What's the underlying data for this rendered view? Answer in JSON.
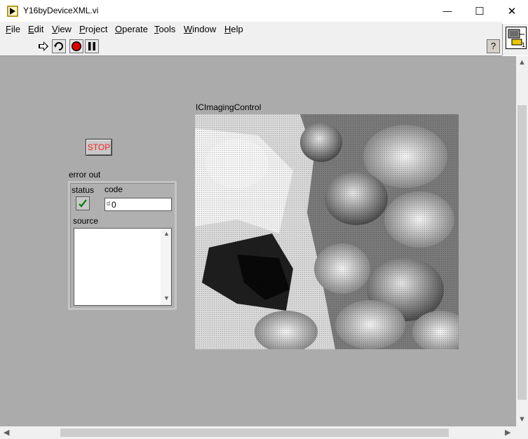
{
  "window": {
    "title": "Y16byDeviceXML.vi",
    "minimize_glyph": "—",
    "maximize_glyph": "☐",
    "close_glyph": "✕"
  },
  "menu": [
    {
      "accel": "F",
      "rest": "ile"
    },
    {
      "accel": "E",
      "rest": "dit"
    },
    {
      "accel": "V",
      "rest": "iew"
    },
    {
      "accel": "P",
      "rest": "roject"
    },
    {
      "accel": "O",
      "rest": "perate"
    },
    {
      "accel": "T",
      "rest": "ools"
    },
    {
      "accel": "W",
      "rest": "indow"
    },
    {
      "accel": "H",
      "rest": "elp"
    }
  ],
  "toolbar": {
    "help_glyph": "?",
    "icons": [
      "run-icon",
      "run-continuously-icon",
      "abort-icon",
      "pause-icon"
    ]
  },
  "connector_pane": {
    "terminal_number": "1"
  },
  "front_panel": {
    "stop_label": "STOP",
    "error_out": {
      "label": "error out",
      "status_label": "status",
      "code_label": "code",
      "code_radix": "d",
      "code_value": "0",
      "source_label": "source",
      "source_value": ""
    },
    "imaging_label": "ICImagingControl"
  },
  "colors": {
    "panel_bg": "#ababab",
    "stop_text": "#ff2020",
    "status_ok": "#1aa31a"
  }
}
